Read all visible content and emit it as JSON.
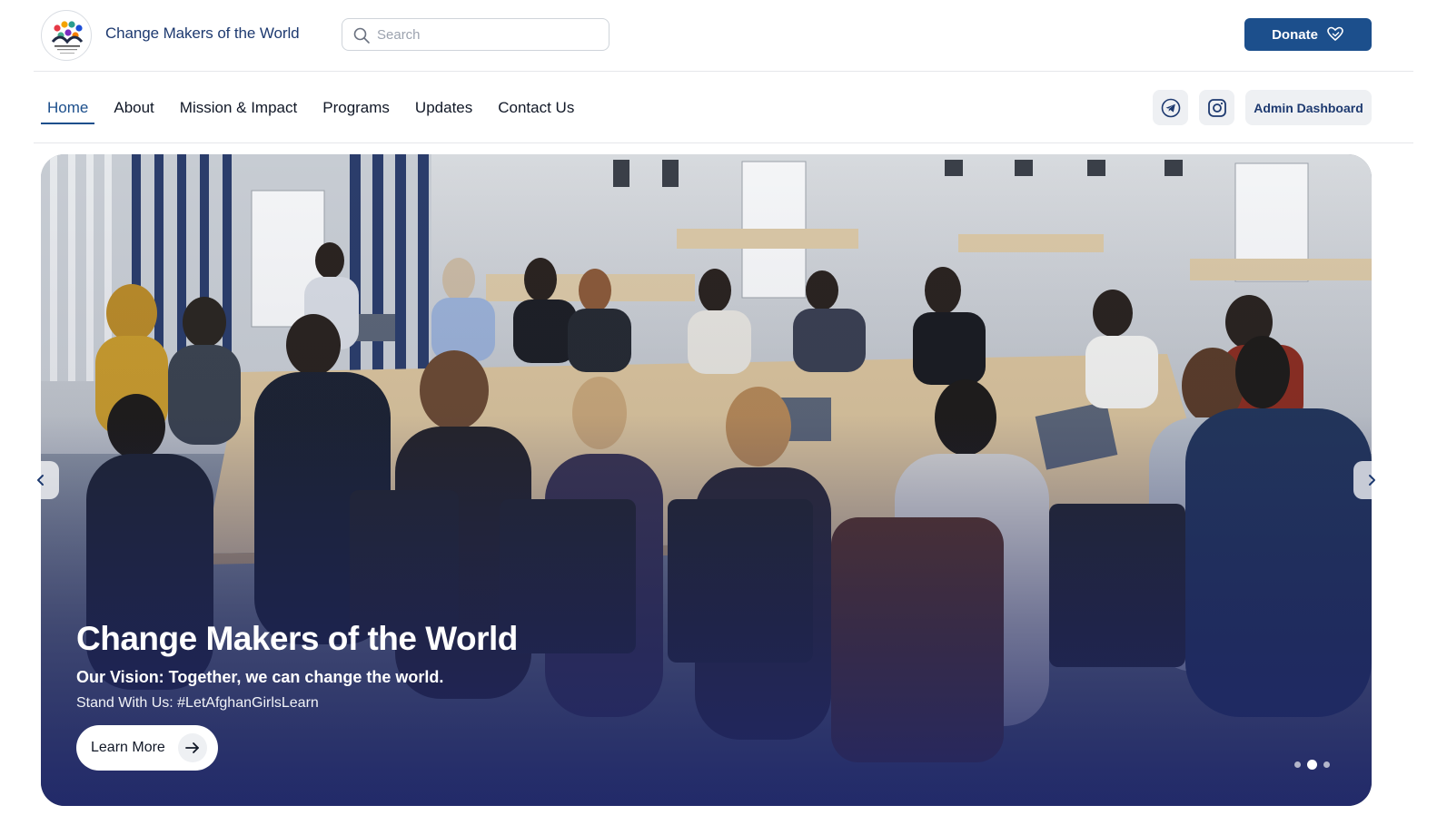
{
  "header": {
    "brand_name": "Change Makers of the World",
    "search_placeholder": "Search",
    "donate_label": "Donate"
  },
  "nav": {
    "items": [
      {
        "label": "Home",
        "active": true
      },
      {
        "label": "About",
        "active": false
      },
      {
        "label": "Mission & Impact",
        "active": false
      },
      {
        "label": "Programs",
        "active": false
      },
      {
        "label": "Updates",
        "active": false
      },
      {
        "label": "Contact Us",
        "active": false
      }
    ],
    "admin_label": "Admin Dashboard"
  },
  "hero": {
    "title": "Change Makers of the World",
    "subtitle": "Our Vision: Together, we can change the world.",
    "tagline": "Stand With Us: #LetAfghanGirlsLearn",
    "cta_label": "Learn More",
    "slides_total": 3,
    "active_slide": 2
  },
  "colors": {
    "brand": "#1c4f8c",
    "brand_text": "#1e3a70",
    "hero_overlay": "#1e266a"
  },
  "icons": [
    "search-icon",
    "heart-hand-icon",
    "telegram-icon",
    "instagram-icon",
    "arrow-right-icon",
    "chevron-left-icon",
    "chevron-right-icon"
  ]
}
